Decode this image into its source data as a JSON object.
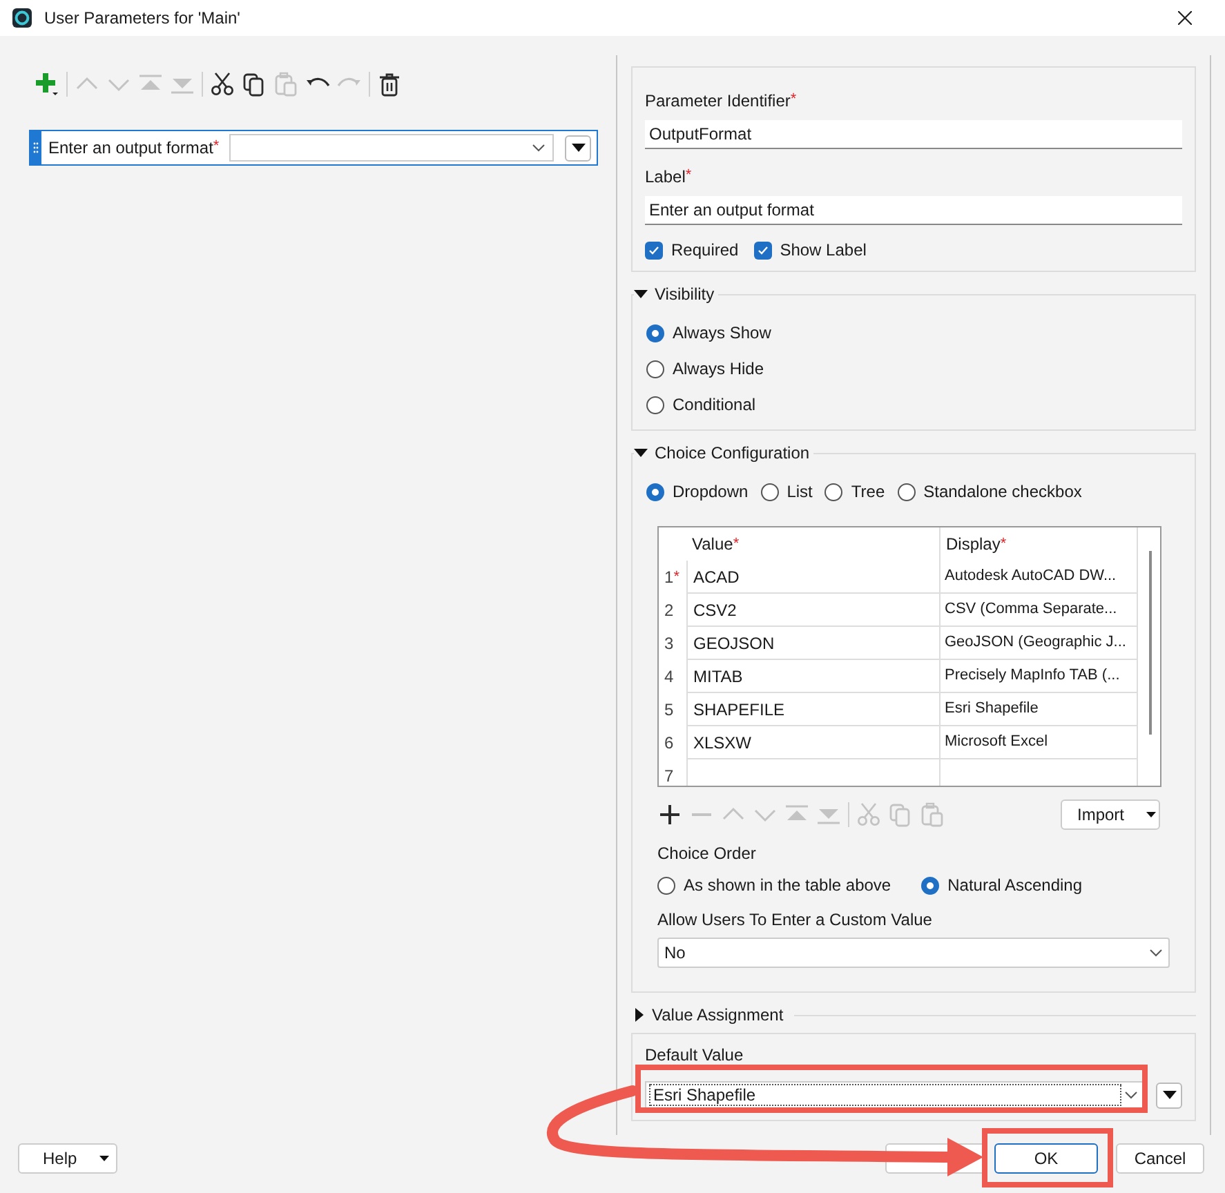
{
  "window": {
    "title": "User Parameters for 'Main'"
  },
  "toolbar": [
    {
      "kind": "add",
      "disabled": false
    },
    {
      "kind": "sep"
    },
    {
      "kind": "up",
      "disabled": true
    },
    {
      "kind": "down",
      "disabled": true
    },
    {
      "kind": "top",
      "disabled": true
    },
    {
      "kind": "bottom",
      "disabled": true
    },
    {
      "kind": "sep"
    },
    {
      "kind": "cut",
      "disabled": false
    },
    {
      "kind": "copy",
      "disabled": false
    },
    {
      "kind": "paste",
      "disabled": true
    },
    {
      "kind": "undo",
      "disabled": false
    },
    {
      "kind": "redo",
      "disabled": true
    },
    {
      "kind": "sep"
    },
    {
      "kind": "delete",
      "disabled": false
    }
  ],
  "parameters": [
    {
      "label": "Enter an output format",
      "mark": "*",
      "selected": true
    }
  ],
  "properties": {
    "identifier_label": "Parameter Identifier",
    "identifier_mark": "*",
    "identifier_value": "OutputFormat",
    "label_label": "Label",
    "label_mark": "*",
    "label_value": "Enter an output format",
    "checkboxes": [
      {
        "label": "Required",
        "checked": true
      },
      {
        "label": "Show Label",
        "checked": true
      }
    ]
  },
  "visibility": {
    "title": "Visibility",
    "expanded": true,
    "options": [
      {
        "label": "Always Show",
        "selected": true
      },
      {
        "label": "Always Hide",
        "selected": false
      },
      {
        "label": "Conditional",
        "selected": false
      }
    ]
  },
  "choice_configuration": {
    "title": "Choice Configuration",
    "expanded": true,
    "modes": [
      {
        "label": "Dropdown",
        "selected": true
      },
      {
        "label": "List",
        "selected": false
      },
      {
        "label": "Tree",
        "selected": false
      },
      {
        "label": "Standalone checkbox",
        "selected": false
      }
    ],
    "table": {
      "columns": [
        {
          "label": "Value",
          "mark": "*"
        },
        {
          "label": "Display",
          "mark": "*"
        }
      ],
      "rows": [
        {
          "number": "1",
          "mark": "*",
          "value": "ACAD",
          "display": "Autodesk AutoCAD DW..."
        },
        {
          "number": "2",
          "value": "CSV2",
          "display": "CSV (Comma Separate..."
        },
        {
          "number": "3",
          "value": "GEOJSON",
          "display": "GeoJSON (Geographic J..."
        },
        {
          "number": "4",
          "value": "MITAB",
          "display": "Precisely MapInfo TAB (..."
        },
        {
          "number": "5",
          "value": "SHAPEFILE",
          "display": "Esri Shapefile"
        },
        {
          "number": "6",
          "value": "XLSXW",
          "display": "Microsoft Excel"
        },
        {
          "number": "7"
        }
      ]
    },
    "table_tools": [
      {
        "kind": "plus",
        "disabled": false
      },
      {
        "kind": "minus",
        "disabled": true
      },
      {
        "kind": "up",
        "disabled": true
      },
      {
        "kind": "down",
        "disabled": true
      },
      {
        "kind": "top",
        "disabled": true
      },
      {
        "kind": "bottom",
        "disabled": true
      },
      {
        "kind": "sep"
      },
      {
        "kind": "cut",
        "disabled": true
      },
      {
        "kind": "copy",
        "disabled": true
      },
      {
        "kind": "paste",
        "disabled": true
      }
    ],
    "import_button": "Import",
    "order_title": "Choice Order",
    "order_options": [
      {
        "label": "As shown in the table above",
        "selected": false
      },
      {
        "label": "Natural Ascending",
        "selected": true
      }
    ],
    "custom_label": "Allow Users To Enter a Custom Value",
    "custom_value": "No"
  },
  "value_assignment": {
    "title": "Value Assignment",
    "expanded": false,
    "default_label": "Default Value",
    "default_value": "Esri Shapefile"
  },
  "footer": {
    "help": "Help",
    "ok": "OK",
    "cancel": "Cancel"
  }
}
